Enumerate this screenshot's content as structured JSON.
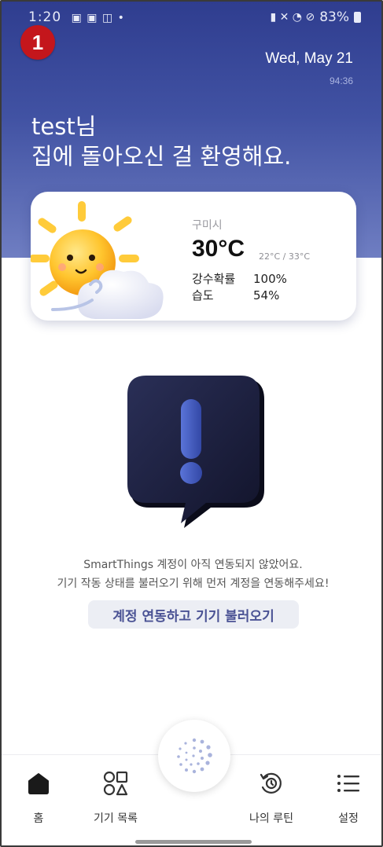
{
  "status": {
    "time": "1:20",
    "battery": "83%"
  },
  "badge": "1",
  "header": {
    "date": "Wed, May 21",
    "clock": "94:36",
    "greeting_line1": "test님",
    "greeting_line2": "집에 돌아오신 걸 환영해요."
  },
  "weather": {
    "city": "구미시",
    "temperature": "30°C",
    "range": "22°C / 33°C",
    "precip_label": "강수확률",
    "precip_value": "100%",
    "humidity_label": "습도",
    "humidity_value": "54%"
  },
  "notice": {
    "line1": "SmartThings 계정이 아직 연동되지 않았어요.",
    "line2": "기기 작동 상태를 불러오기 위해 먼저 계정을 연동해주세요!",
    "link_label": "계정 연동하고 기기 불러오기"
  },
  "nav": {
    "home": "홈",
    "devices": "기기 목록",
    "routines": "나의 루틴",
    "settings": "설정"
  },
  "colors": {
    "hero_top": "#2f3d8f",
    "hero_bottom": "#6f7ec2",
    "link_text": "#4a5294",
    "badge": "#c4161c"
  }
}
